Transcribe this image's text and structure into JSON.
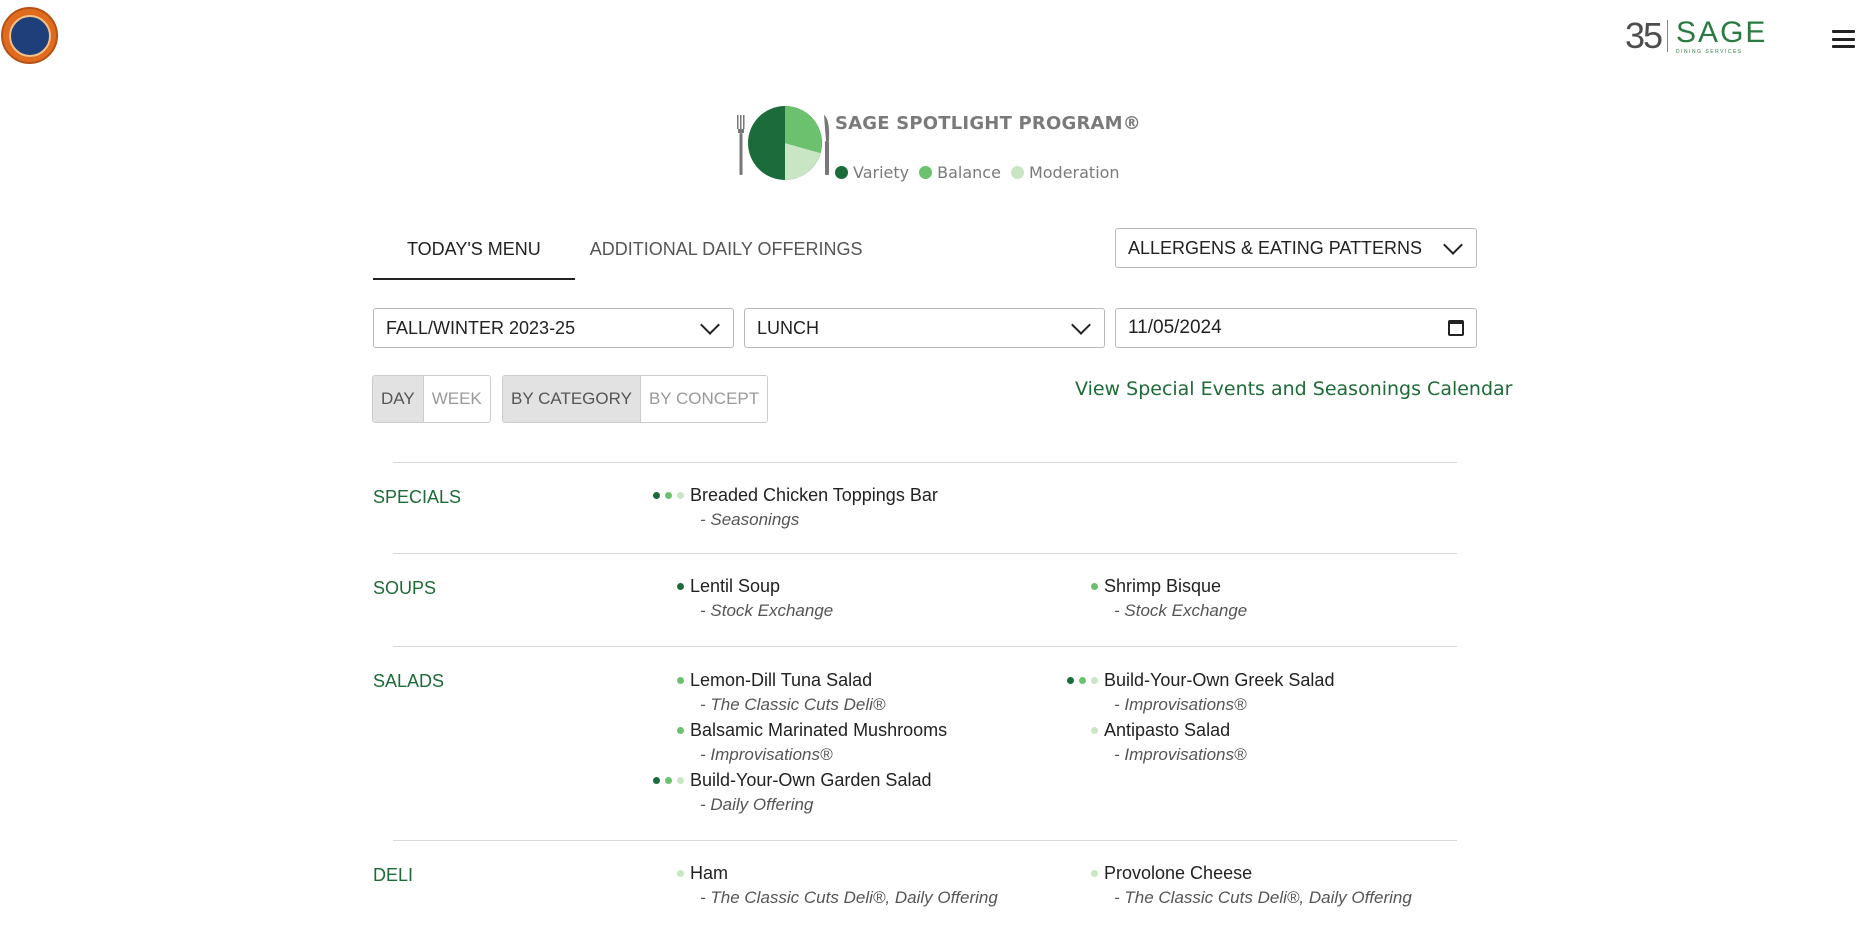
{
  "header": {
    "school_logo": "school-crest-logo",
    "brand": {
      "years": "35",
      "word": "SAGE",
      "sub": "DINING SERVICES"
    },
    "menu_icon": "hamburger-menu-icon"
  },
  "spotlight": {
    "title": "SAGE SPOTLIGHT PROGRAM®",
    "legend": [
      {
        "label": "Variety",
        "color": "#1c6b3a"
      },
      {
        "label": "Balance",
        "color": "#6cc16f"
      },
      {
        "label": "Moderation",
        "color": "#c8e6c4"
      }
    ]
  },
  "tabs": [
    {
      "label": "TODAY'S MENU",
      "active": true
    },
    {
      "label": "ADDITIONAL DAILY OFFERINGS",
      "active": false
    }
  ],
  "allergens_dropdown": {
    "label": "ALLERGENS & EATING PATTERNS"
  },
  "filters": {
    "season": "FALL/WINTER 2023-25",
    "meal": "LUNCH",
    "date": "11/05/2024"
  },
  "view_toggle": {
    "day": "DAY",
    "week": "WEEK",
    "active": "DAY"
  },
  "group_toggle": {
    "category": "BY CATEGORY",
    "concept": "BY CONCEPT",
    "active": "BY CATEGORY"
  },
  "calendar_link": "View Special Events and Seasonings Calendar",
  "colors": {
    "variety": "#1c6b3a",
    "balance": "#6cc16f",
    "moderation": "#c8e6c4",
    "accent": "#1d6b37"
  },
  "menu": {
    "specials": {
      "category": "SPECIALS",
      "left": [
        {
          "name": "Breaded Chicken Toppings Bar",
          "station": "- Seasonings",
          "dots": [
            "variety",
            "balance",
            "moderation"
          ]
        }
      ],
      "right": []
    },
    "soups": {
      "category": "SOUPS",
      "left": [
        {
          "name": "Lentil Soup",
          "station": "- Stock Exchange",
          "dots": [
            "variety"
          ]
        }
      ],
      "right": [
        {
          "name": "Shrimp Bisque",
          "station": "- Stock Exchange",
          "dots": [
            "balance"
          ]
        }
      ]
    },
    "salads": {
      "category": "SALADS",
      "left": [
        {
          "name": "Lemon-Dill Tuna Salad",
          "station": "- The Classic Cuts Deli®",
          "dots": [
            "balance"
          ]
        },
        {
          "name": "Balsamic Marinated Mushrooms",
          "station": "- Improvisations®",
          "dots": [
            "balance"
          ]
        },
        {
          "name": "Build-Your-Own Garden Salad",
          "station": "- Daily Offering",
          "dots": [
            "variety",
            "balance",
            "moderation"
          ]
        }
      ],
      "right": [
        {
          "name": "Build-Your-Own Greek Salad",
          "station": "- Improvisations®",
          "dots": [
            "variety",
            "balance",
            "moderation"
          ]
        },
        {
          "name": "Antipasto Salad",
          "station": "- Improvisations®",
          "dots": [
            "moderation"
          ]
        }
      ]
    },
    "deli": {
      "category": "DELI",
      "left": [
        {
          "name": "Ham",
          "station": "- The Classic Cuts Deli®, Daily Offering",
          "dots": [
            "moderation"
          ]
        }
      ],
      "right": [
        {
          "name": "Provolone Cheese",
          "station": "- The Classic Cuts Deli®, Daily Offering",
          "dots": [
            "moderation"
          ]
        }
      ]
    }
  }
}
